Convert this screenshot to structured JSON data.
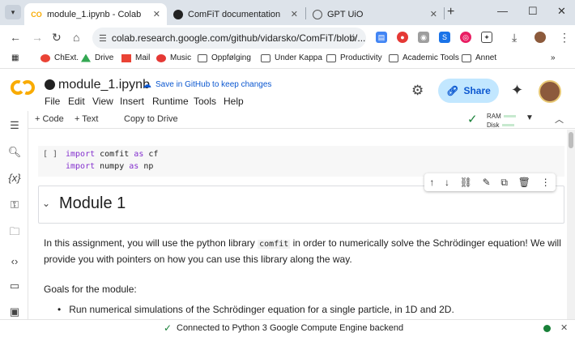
{
  "browser": {
    "tabs": [
      {
        "title": "module_1.ipynb - Colab",
        "active": true,
        "favicon": "colab-icon"
      },
      {
        "title": "ComFiT documentation",
        "active": false,
        "favicon": "github-icon"
      },
      {
        "title": "GPT UiO",
        "active": false,
        "favicon": "globe-icon"
      }
    ],
    "url": "colab.research.google.com/github/vidarsko/ComFiT/blob/...",
    "bookmarks": [
      "ChExt.",
      "Drive",
      "Mail",
      "Music",
      "Oppfølging",
      "Under Kappa",
      "Productivity",
      "Academic Tools",
      "Annet"
    ],
    "bookmarks_more": "»"
  },
  "colab": {
    "notebook_title": "module_1.ipynb",
    "save_link": "Save in GitHub to keep changes",
    "menu": [
      "File",
      "Edit",
      "View",
      "Insert",
      "Runtime",
      "Tools",
      "Help"
    ],
    "share_label": "Share",
    "toolbar": {
      "add_code": "+ Code",
      "add_text": "+ Text",
      "copy_to_drive": "Copy to Drive"
    },
    "resources": {
      "ram_label": "RAM",
      "disk_label": "Disk"
    }
  },
  "cells": {
    "code_cell": {
      "bracket": "[ ]",
      "lines": [
        {
          "kw1": "import",
          "mod": " comfit ",
          "kw2": "as",
          "alias": " cf"
        },
        {
          "kw1": "import",
          "mod": " numpy ",
          "kw2": "as",
          "alias": " np"
        }
      ]
    },
    "heading": "Module 1",
    "intro_before_code": "In this assignment, you will use the python library ",
    "intro_code": "comfit",
    "intro_after_code": " in order to numerically solve the Schrödinger equation! We will provide you with pointers on how you can use this library along the way.",
    "goals_label": "Goals for the module:",
    "bullets": [
      "Run numerical simulations of the Schrödinger equation for a single particle, in 1D and 2D."
    ]
  },
  "status": {
    "text": "Connected to Python 3 Google Compute Engine backend"
  },
  "colors": {
    "accent": "#0b57d0",
    "share_bg": "#c2e7ff",
    "keyword": "#8430ce",
    "connected": "#188038",
    "colab_orange": "#f9ab00"
  }
}
